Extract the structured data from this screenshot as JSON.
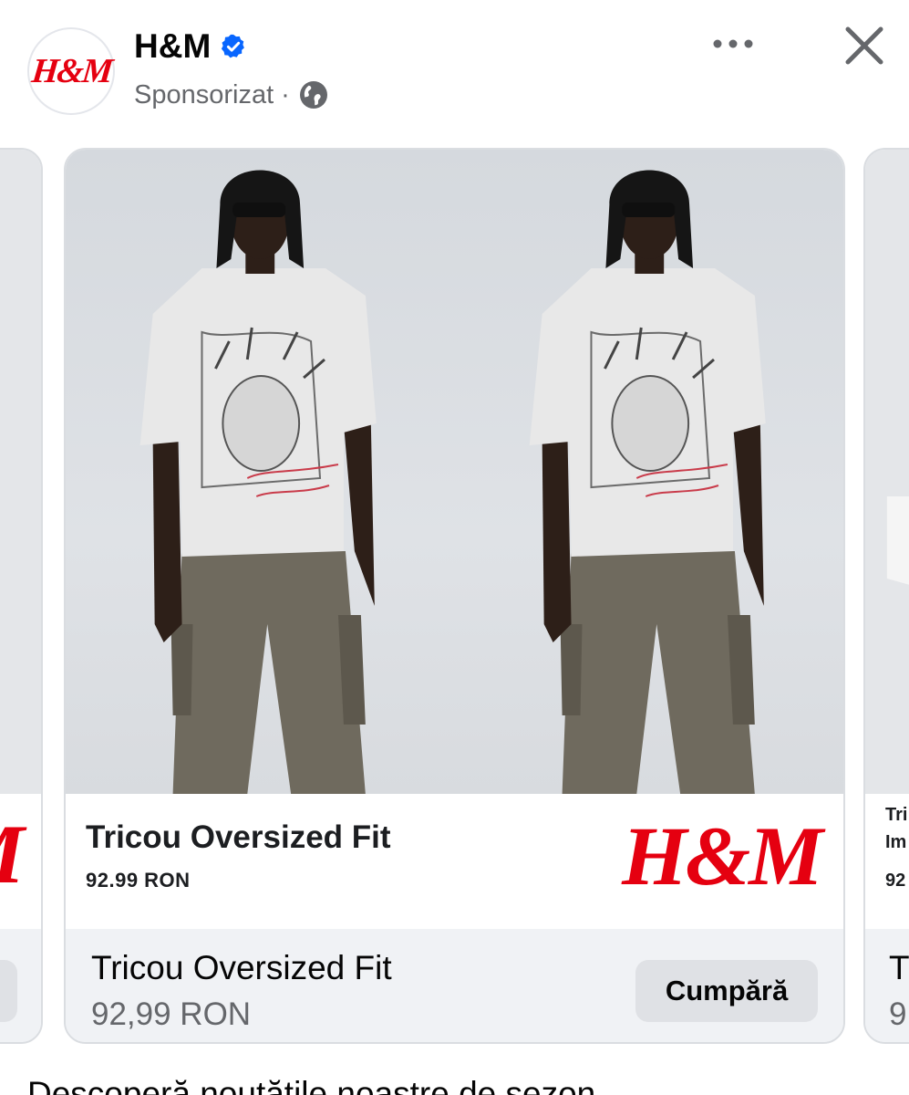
{
  "header": {
    "page_name": "H&M",
    "sponsored_label": "Sponsorizat",
    "dot": "·",
    "avatar_logo": "H&M",
    "icons": {
      "verified": "verified-badge-icon",
      "globe": "globe-icon",
      "more": "more-options-icon",
      "close": "close-icon"
    }
  },
  "carousel": {
    "prev_card": {
      "logo": "H&M"
    },
    "main_card": {
      "title": "Tricou Oversized Fit",
      "price": "92.99 RON",
      "logo": "H&M",
      "footer_title": "Tricou Oversized Fit",
      "footer_price": "92,99 RON",
      "cta_label": "Cumpără"
    },
    "next_card": {
      "title_line1": "Tri",
      "title_line2": "Im",
      "price": "92",
      "footer_title": "T",
      "footer_price": "9"
    }
  },
  "caption": "Descoperă noutățile noastre de sezon",
  "colors": {
    "brand_red": "#e50010",
    "verified_blue": "#0866ff",
    "muted_text": "#65676b",
    "footer_bg": "#f0f2f5",
    "button_bg": "#dfe1e5"
  }
}
